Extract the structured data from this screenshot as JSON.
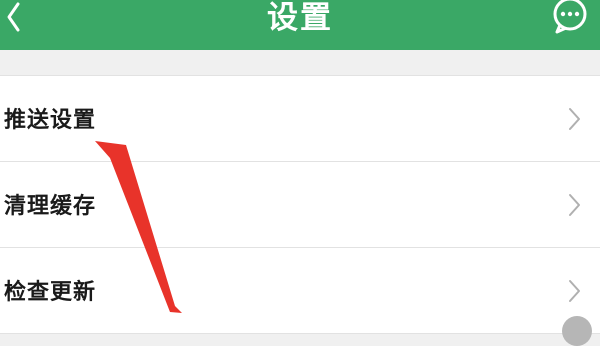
{
  "header": {
    "title": "设置",
    "back_icon": "chevron-left-icon",
    "chat_icon": "chat-bubble-icon",
    "color": "#3aa866"
  },
  "settings": {
    "items": [
      {
        "label": "推送设置",
        "icon": "chevron-right-icon"
      },
      {
        "label": "清理缓存",
        "icon": "chevron-right-icon"
      },
      {
        "label": "检查更新",
        "icon": "chevron-right-icon"
      }
    ]
  },
  "annotation": {
    "arrow_color": "#e8332a",
    "points_to": "推送设置"
  }
}
